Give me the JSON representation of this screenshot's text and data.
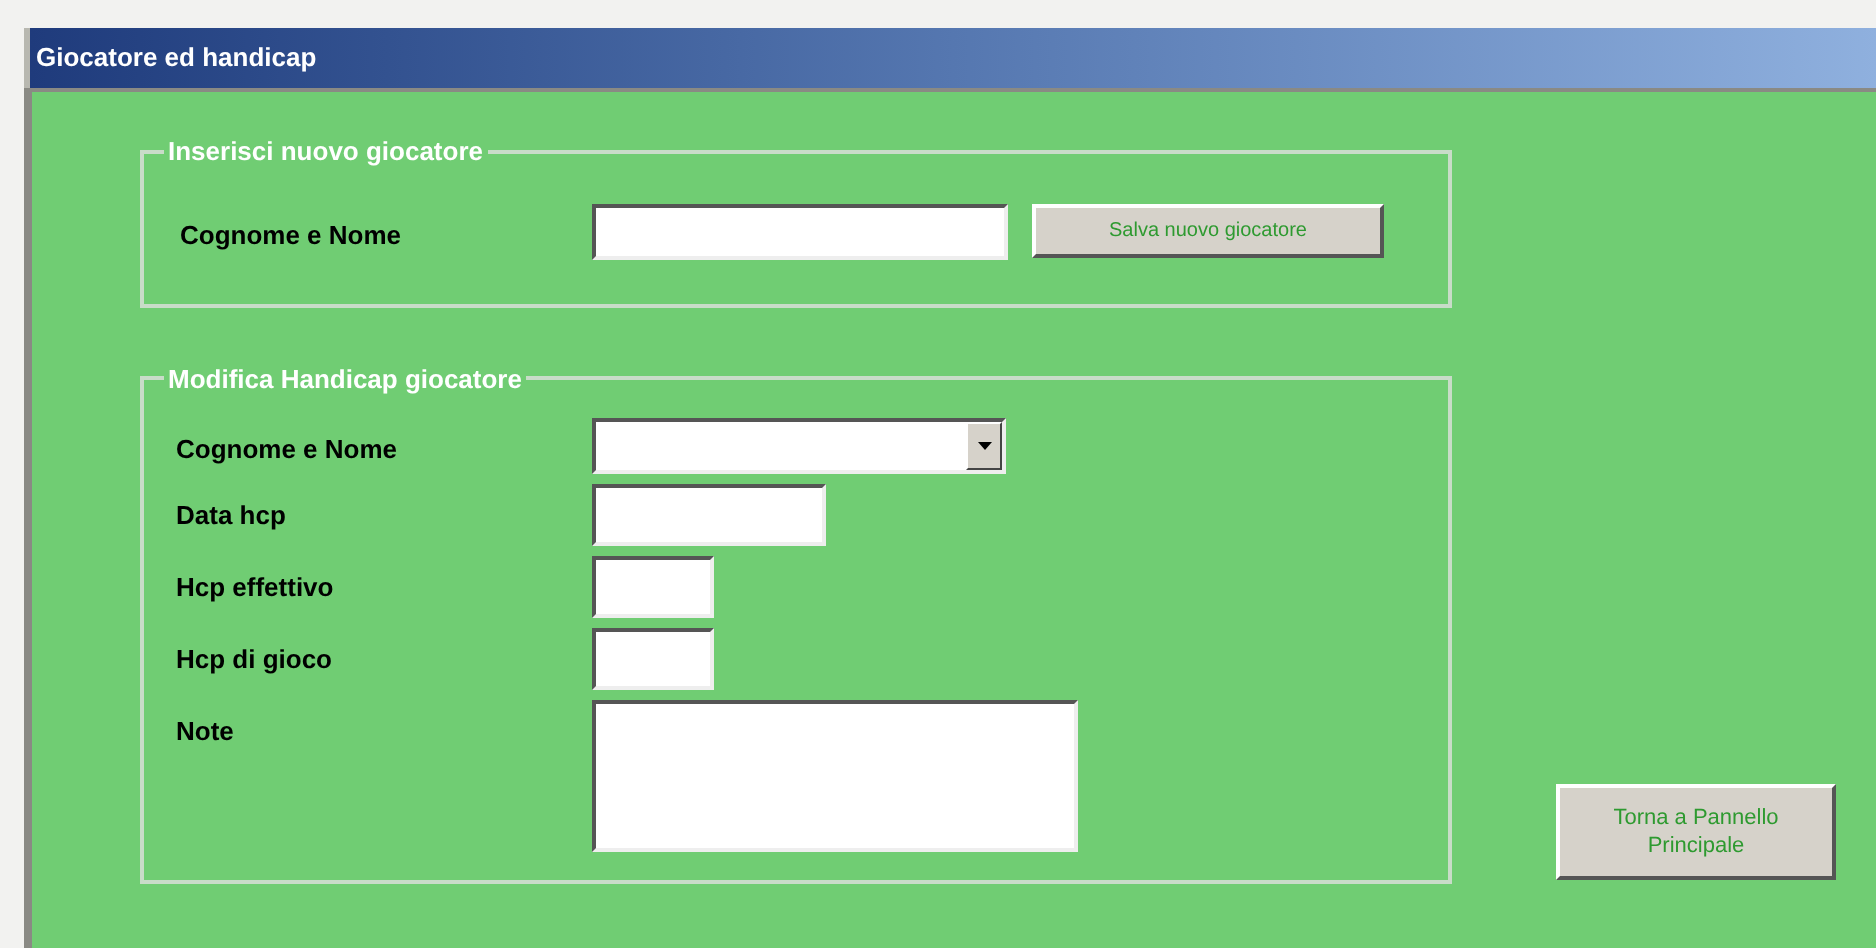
{
  "window": {
    "title": "Giocatore ed handicap"
  },
  "sections": [
    {
      "title": "Inserisci nuovo giocatore",
      "rows": [
        {
          "label": "Cognome e Nome",
          "kind": "text",
          "button": "Salva nuovo giocatore"
        }
      ]
    },
    {
      "title": "Modifica Handicap giocatore",
      "rows": [
        {
          "label": "Cognome e Nome",
          "kind": "dropdown"
        },
        {
          "label": "Data hcp",
          "kind": "date"
        },
        {
          "label": "Hcp effettivo",
          "kind": "number"
        },
        {
          "label": "Hcp di gioco",
          "kind": "number"
        },
        {
          "label": "Note",
          "kind": "memo"
        }
      ]
    }
  ],
  "button": {
    "label": "Torna a Pannello Principale"
  }
}
